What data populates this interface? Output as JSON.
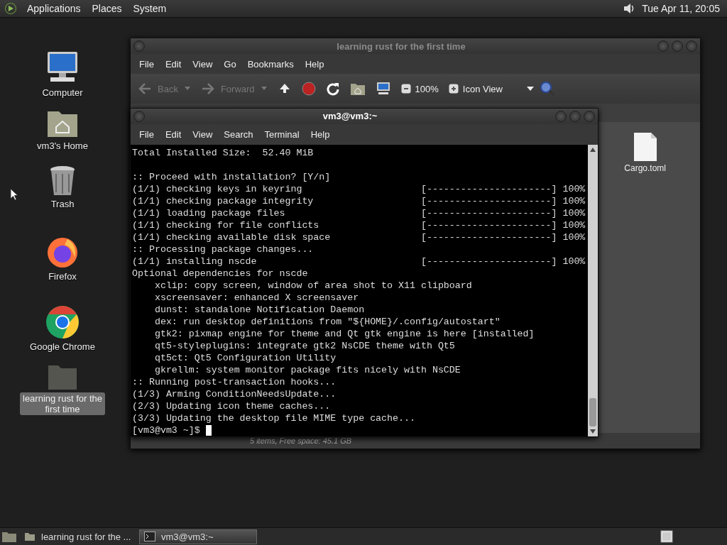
{
  "top_panel": {
    "menus": [
      "Applications",
      "Places",
      "System"
    ],
    "clock": "Tue Apr 11, 20:05"
  },
  "desktop_icons": [
    {
      "kind": "computer",
      "label": "Computer",
      "selected": false
    },
    {
      "kind": "home",
      "label": "vm3's Home",
      "selected": false
    },
    {
      "kind": "trash",
      "label": "Trash",
      "selected": false
    },
    {
      "kind": "firefox",
      "label": "Firefox",
      "selected": false
    },
    {
      "kind": "chrome",
      "label": "Google Chrome",
      "selected": false
    },
    {
      "kind": "folder",
      "label": "learning rust for the first time",
      "selected": true
    }
  ],
  "file_manager": {
    "title": "learning rust for the first time",
    "menu": [
      "File",
      "Edit",
      "View",
      "Go",
      "Bookmarks",
      "Help"
    ],
    "toolbar": {
      "back": {
        "label": "Back",
        "disabled": true
      },
      "forward": {
        "label": "Forward",
        "disabled": true
      },
      "zoom": "100%",
      "view": "Icon View"
    },
    "files": [
      "Cargo.toml"
    ],
    "status": "5 items, Free space: 45.1 GB"
  },
  "terminal": {
    "title": "vm3@vm3:~",
    "menu": [
      "File",
      "Edit",
      "View",
      "Search",
      "Terminal",
      "Help"
    ],
    "lines": [
      {
        "text": "Total Installed Size:  52.40 MiB"
      },
      {
        "kind": "blank"
      },
      {
        "text": ":: Proceed with installation? [Y/n]"
      },
      {
        "text": "(1/1) checking keys in keyring",
        "bar": "[----------------------]",
        "percent": "100%"
      },
      {
        "text": "(1/1) checking package integrity",
        "bar": "[----------------------]",
        "percent": "100%"
      },
      {
        "text": "(1/1) loading package files",
        "bar": "[----------------------]",
        "percent": "100%"
      },
      {
        "text": "(1/1) checking for file conflicts",
        "bar": "[----------------------]",
        "percent": "100%"
      },
      {
        "text": "(1/1) checking available disk space",
        "bar": "[----------------------]",
        "percent": "100%"
      },
      {
        "text": ":: Processing package changes..."
      },
      {
        "text": "(1/1) installing nscde",
        "bar": "[----------------------]",
        "percent": "100%"
      },
      {
        "text": "Optional dependencies for nscde"
      },
      {
        "text": "    xclip: copy screen, window of area shot to X11 clipboard"
      },
      {
        "text": "    xscreensaver: enhanced X screensaver"
      },
      {
        "text": "    dunst: standalone Notification Daemon"
      },
      {
        "text": "    dex: run desktop definitions from \"${HOME}/.config/autostart\""
      },
      {
        "text": "    gtk2: pixmap engine for theme and Qt gtk engine is here [installed]"
      },
      {
        "text": "    qt5-styleplugins: integrate gtk2 NsCDE theme with Qt5"
      },
      {
        "text": "    qt5ct: Qt5 Configuration Utility"
      },
      {
        "text": "    gkrellm: system monitor package fits nicely with NsCDE"
      },
      {
        "text": ":: Running post-transaction hooks..."
      },
      {
        "text": "(1/3) Arming ConditionNeedsUpdate..."
      },
      {
        "text": "(2/3) Updating icon theme caches..."
      },
      {
        "text": "(3/3) Updating the desktop file MIME type cache..."
      }
    ],
    "prompt": "[vm3@vm3 ~]$"
  },
  "taskbar": [
    {
      "label": "learning rust for the ...",
      "kind": "folder",
      "selected": false
    },
    {
      "label": "vm3@vm3:~",
      "kind": "terminal",
      "selected": true
    }
  ]
}
